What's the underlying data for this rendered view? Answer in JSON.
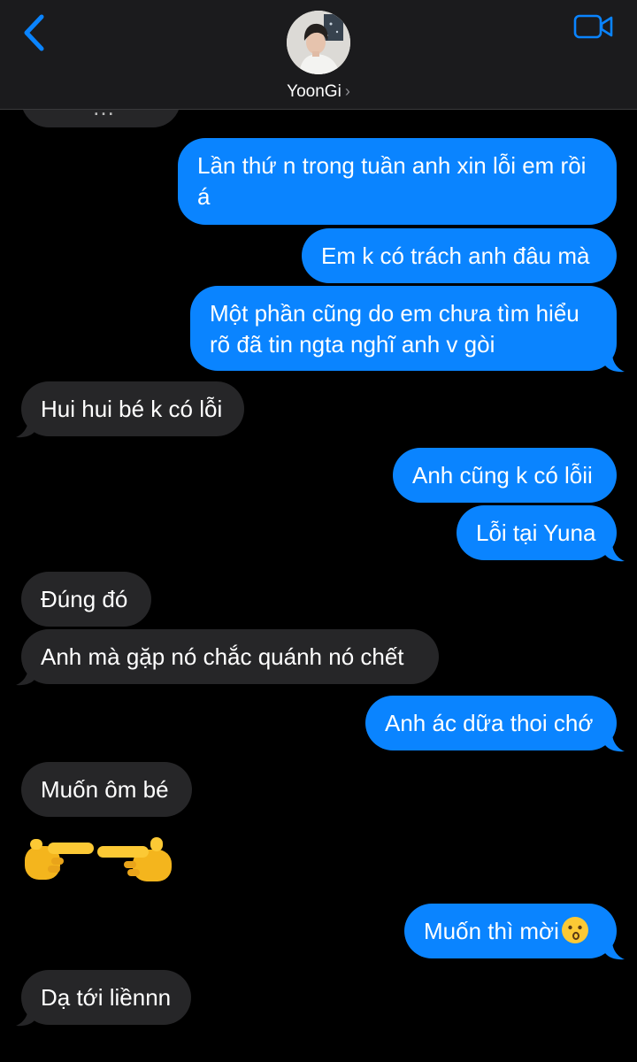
{
  "header": {
    "contact_name": "YoonGi",
    "back_icon": "chevron-left-icon",
    "video_icon": "video-camera-icon",
    "accent_color": "#0a84ff"
  },
  "messages": [
    {
      "from": "incoming",
      "text": "…",
      "partial": true
    },
    {
      "from": "outgoing",
      "text": "Lần thứ n trong tuần anh xin lỗi em rồi á"
    },
    {
      "from": "outgoing",
      "text": "Em k có trách anh đâu mà"
    },
    {
      "from": "outgoing",
      "text": "Một phần cũng do em chưa tìm hiểu rõ đã tin ngta nghĩ anh v gòi"
    },
    {
      "from": "incoming",
      "text": "Hui hui bé k có lỗi"
    },
    {
      "from": "outgoing",
      "text": "Anh cũng k có lỗii"
    },
    {
      "from": "outgoing",
      "text": "Lỗi tại Yuna"
    },
    {
      "from": "incoming",
      "text": "Đúng đó"
    },
    {
      "from": "incoming",
      "text": "Anh mà gặp nó chắc quánh nó chết"
    },
    {
      "from": "outgoing",
      "text": "Anh ác dữa thoi chớ"
    },
    {
      "from": "incoming",
      "text": "Muốn ôm bé"
    },
    {
      "from": "incoming",
      "text": "",
      "emoji": "pointing-fingers-emoji"
    },
    {
      "from": "outgoing",
      "text": "Muốn thì mời",
      "emoji": "kissing-face-emoji"
    },
    {
      "from": "incoming",
      "text": "Dạ tới liềnnn"
    }
  ],
  "colors": {
    "outgoing_bubble": "#0a84ff",
    "incoming_bubble": "#262628",
    "background": "#000000",
    "header_bg": "#1b1b1d"
  }
}
